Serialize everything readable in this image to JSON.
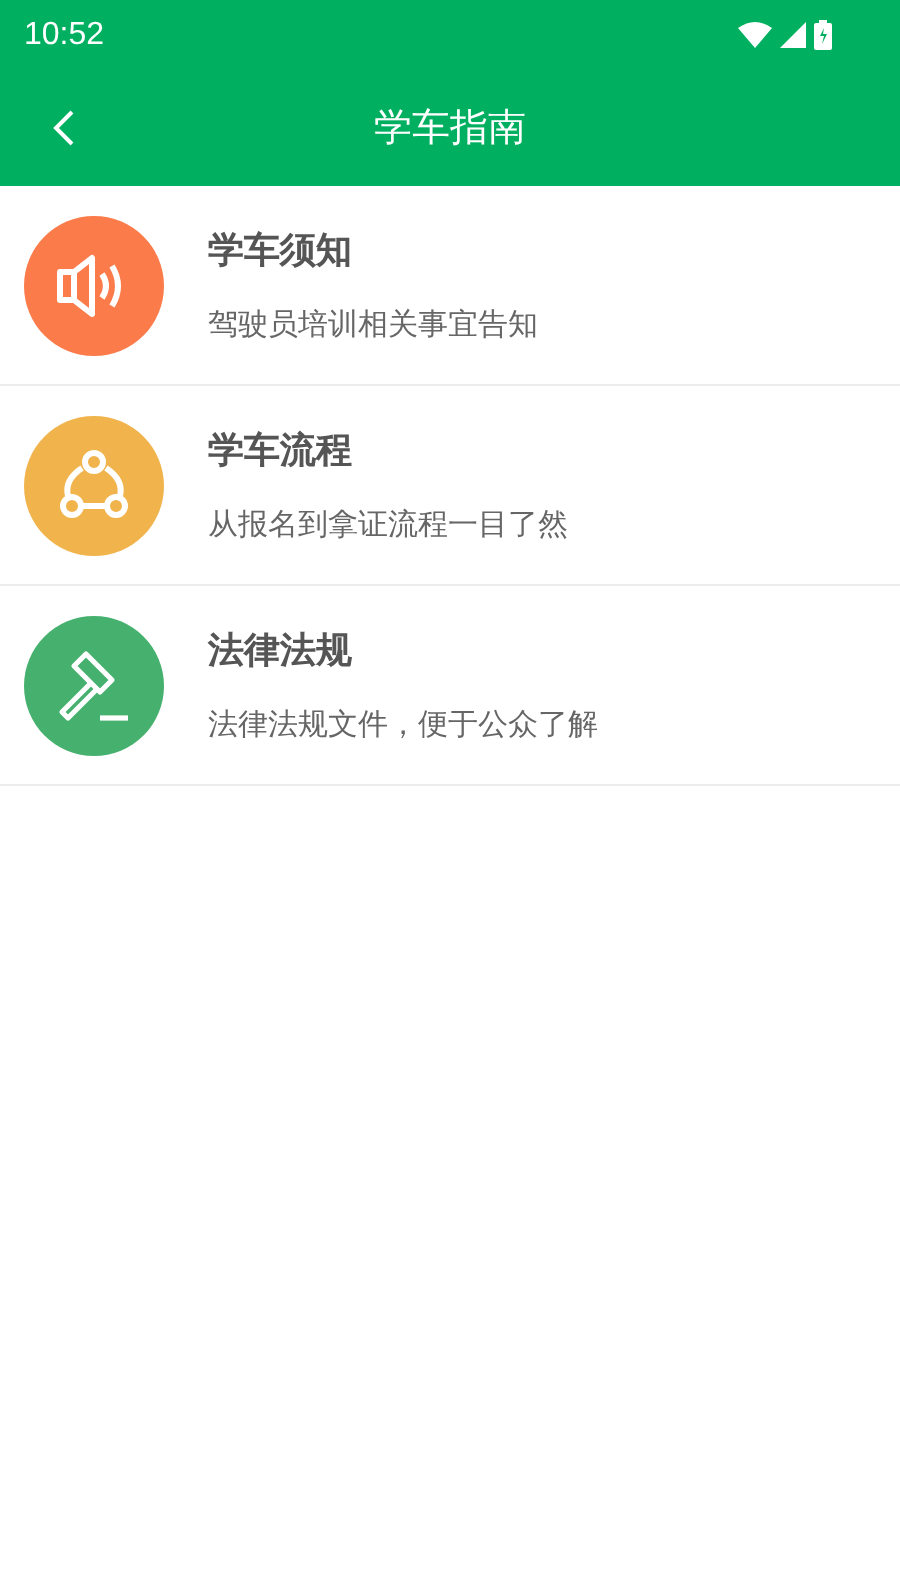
{
  "status_bar": {
    "time": "10:52"
  },
  "header": {
    "title": "学车指南"
  },
  "items": [
    {
      "kind": "speaker",
      "color": "#fb7b4a",
      "title": "学车须知",
      "subtitle": "驾驶员培训相关事宜告知"
    },
    {
      "kind": "flow",
      "color": "#f1b44d",
      "title": "学车流程",
      "subtitle": "从报名到拿证流程一目了然"
    },
    {
      "kind": "gavel",
      "color": "#46b16e",
      "title": "法律法规",
      "subtitle": "法律法规文件，便于公众了解"
    }
  ]
}
